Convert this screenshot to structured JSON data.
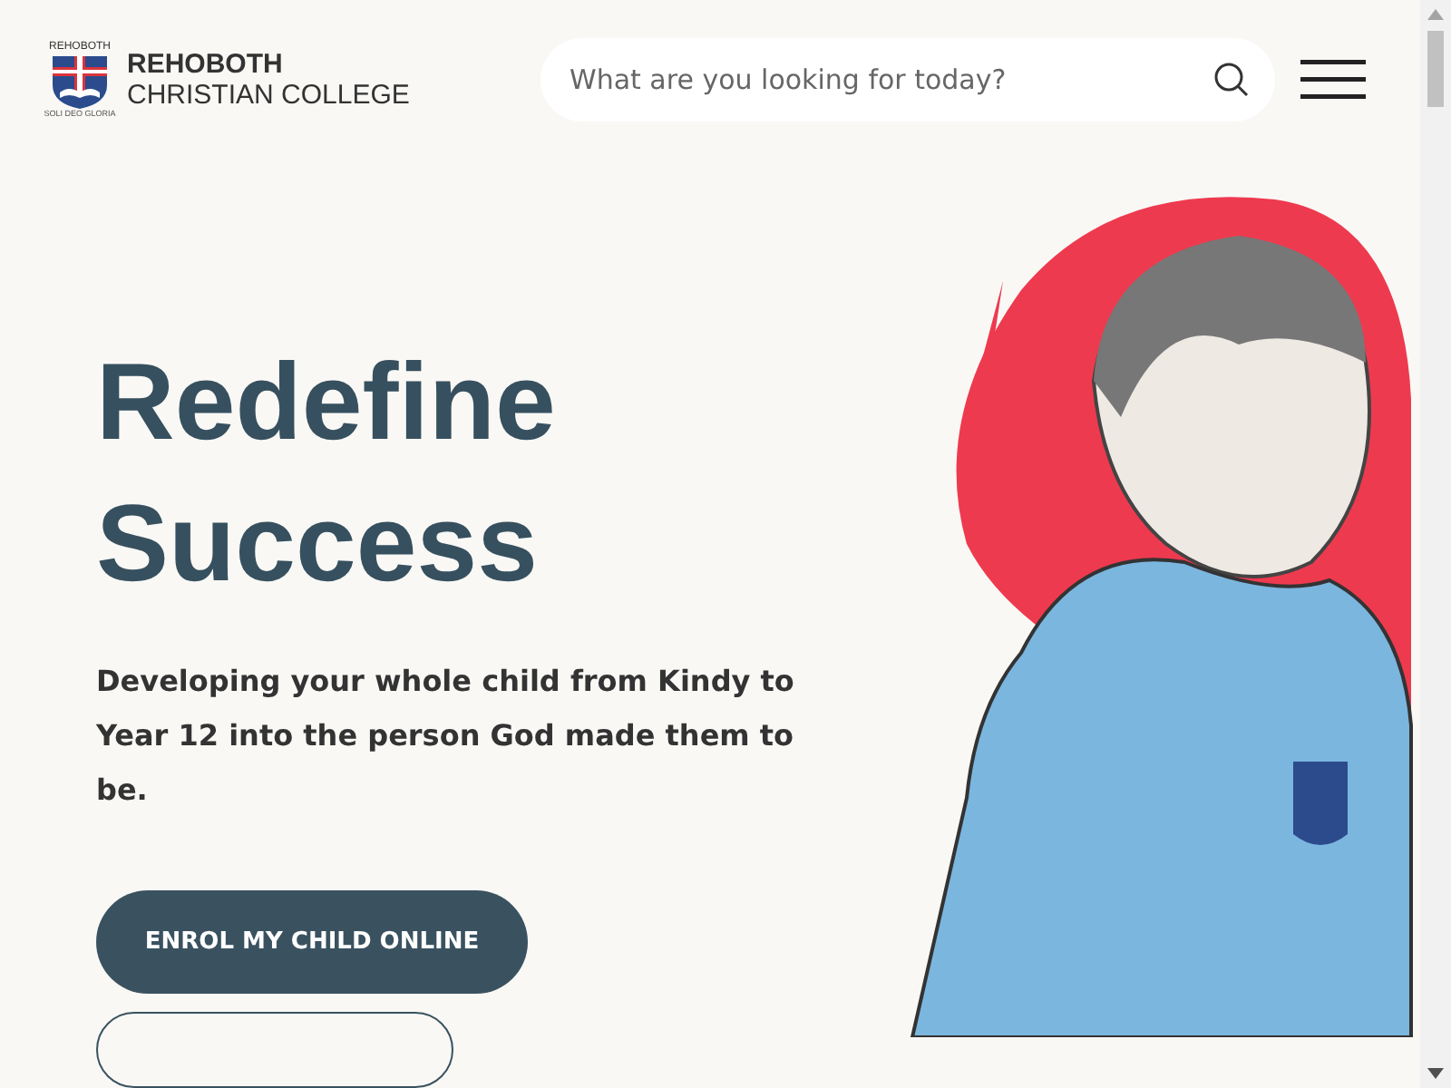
{
  "logo": {
    "crest_text": "REHOBOTH",
    "motto": "SOLI DEO GLORIA",
    "name_line_1": "REHOBOTH",
    "name_line_2": "CHRISTIAN COLLEGE"
  },
  "search": {
    "placeholder": "What are you looking for today?"
  },
  "hero": {
    "title_line_1": "Redefine",
    "title_line_2": "Success",
    "subtitle": "Developing your whole child from Kindy to Year 12 into the person God made them to be.",
    "primary_button": "ENROL MY CHILD ONLINE"
  }
}
